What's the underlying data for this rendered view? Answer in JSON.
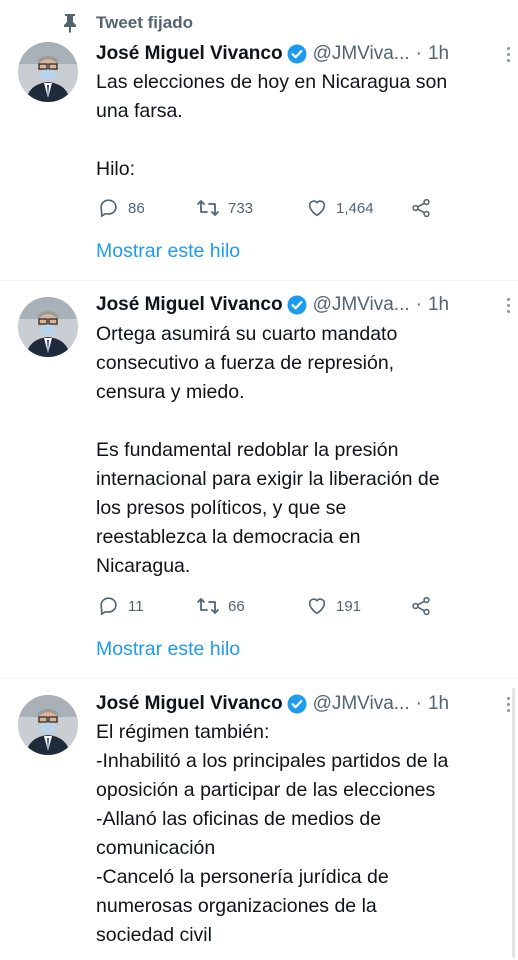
{
  "pinned": {
    "label": "Tweet fijado",
    "icon": "pin-icon"
  },
  "tweets": [
    {
      "name": "José Miguel Vivanco",
      "handle": "@JMViva...",
      "separator": "·",
      "time": "1h",
      "lines": [
        "Las elecciones de hoy en Nicaragua son",
        "una farsa.",
        "",
        "Hilo:"
      ],
      "replies": "86",
      "retweets": "733",
      "likes": "1,464",
      "show_thread": "Mostrar este hilo"
    },
    {
      "name": "José Miguel Vivanco",
      "handle": "@JMViva...",
      "separator": "·",
      "time": "1h",
      "lines": [
        "Ortega asumirá su cuarto mandato",
        "consecutivo a fuerza de represión,",
        "censura y miedo.",
        "",
        "Es fundamental redoblar la presión",
        "internacional para exigir la liberación de",
        "los presos políticos, y que se",
        "reestablezca la democracia en",
        "Nicaragua."
      ],
      "replies": "11",
      "retweets": "66",
      "likes": "191",
      "show_thread": "Mostrar este hilo"
    },
    {
      "name": "José Miguel Vivanco",
      "handle": "@JMViva...",
      "separator": "·",
      "time": "1h",
      "lines": [
        "El régimen también:",
        "-Inhabilitó a los principales partidos de la",
        "oposición a participar de las elecciones",
        "-Allanó las oficinas de medios de",
        "comunicación",
        "-Canceló la personería jurídica de",
        "numerosas organizaciones de la",
        "sociedad civil"
      ]
    }
  ],
  "colors": {
    "accent": "#1d9bf0",
    "muted": "#536471",
    "text": "#0f1419",
    "verified": "#1d9bf0"
  }
}
